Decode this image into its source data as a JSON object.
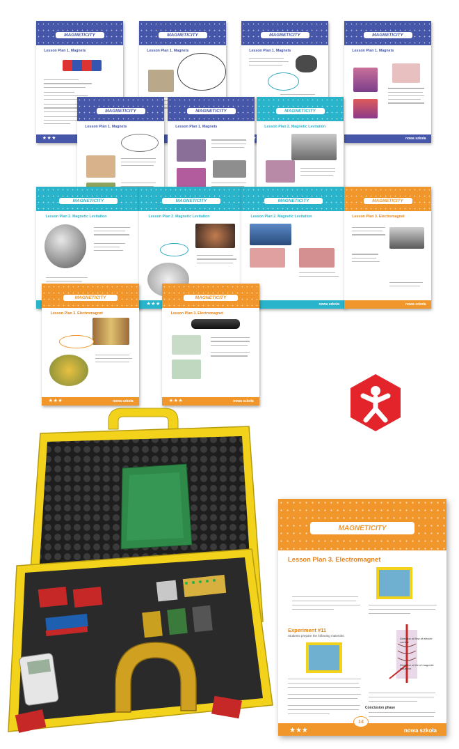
{
  "pages": [
    {
      "title": "MAGNETICITY",
      "lesson": "Lesson Plan 1. Magnets"
    },
    {
      "title": "MAGNETICITY",
      "lesson": "Lesson Plan 1. Magnets"
    },
    {
      "title": "MAGNETICITY",
      "lesson": "Lesson Plan 1. Magnets"
    },
    {
      "title": "MAGNETICITY",
      "lesson": "Lesson Plan 1. Magnets"
    },
    {
      "title": "MAGNETICITY",
      "lesson": "Lesson Plan 1. Magnets"
    },
    {
      "title": "MAGNETICITY",
      "lesson": "Lesson Plan 1. Magnets"
    },
    {
      "title": "MAGNETICITY",
      "lesson": "Lesson Plan 2. Magnetic Levitation"
    },
    {
      "title": "MAGNETICITY",
      "lesson": "Lesson Plan 2. Magnetic Levitation"
    },
    {
      "title": "MAGNETICITY",
      "lesson": "Lesson Plan 2. Magnetic Levitation"
    },
    {
      "title": "MAGNETICITY",
      "lesson": "Lesson Plan 2. Magnetic Levitation"
    },
    {
      "title": "MAGNETICITY",
      "lesson": "Lesson Plan 3. Electromagnet"
    },
    {
      "title": "MAGNETICITY",
      "lesson": "Lesson Plan 3. Electromagnet"
    },
    {
      "title": "MAGNETICITY",
      "lesson": "Lesson Plan 3. Electromagnet"
    }
  ],
  "footer": {
    "stars": "★★★",
    "brand": "nowa szkoła"
  },
  "big_page": {
    "title": "MAGNETICITY",
    "lesson": "Lesson Plan 3. Electromagnet",
    "experiment": "Experiment #11",
    "intro": "Students prepare the following materials:",
    "arrow_caption_1": "Direction of flow of electric current",
    "arrow_caption_2": "Direction of the of magnetic induction",
    "conclusion": "Conclusion phase",
    "page_number": "14",
    "stars": "★★★",
    "brand": "nowa szkoła"
  },
  "colors": {
    "blue": "#4656a8",
    "teal": "#2ab4cb",
    "orange": "#f0962a",
    "logo_red": "#e3242b",
    "case_yellow": "#f2d21b"
  },
  "icons": [
    "nowa-szkola-logo-icon",
    "magnets-kit-case-image"
  ]
}
